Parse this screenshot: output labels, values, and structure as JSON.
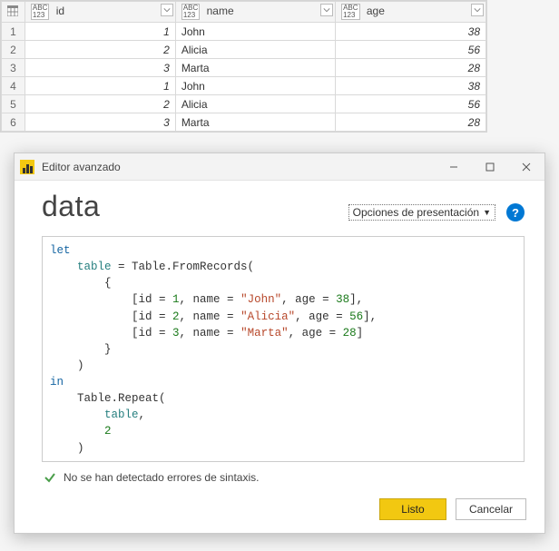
{
  "table": {
    "columns": [
      {
        "name": "id",
        "type_label_top": "ABC",
        "type_label_bot": "123"
      },
      {
        "name": "name",
        "type_label_top": "ABC",
        "type_label_bot": "123"
      },
      {
        "name": "age",
        "type_label_top": "ABC",
        "type_label_bot": "123"
      }
    ],
    "rows": [
      {
        "n": "1",
        "id": "1",
        "name": "John",
        "age": "38"
      },
      {
        "n": "2",
        "id": "2",
        "name": "Alicia",
        "age": "56"
      },
      {
        "n": "3",
        "id": "3",
        "name": "Marta",
        "age": "28"
      },
      {
        "n": "4",
        "id": "1",
        "name": "John",
        "age": "38"
      },
      {
        "n": "5",
        "id": "2",
        "name": "Alicia",
        "age": "56"
      },
      {
        "n": "6",
        "id": "3",
        "name": "Marta",
        "age": "28"
      }
    ]
  },
  "editor": {
    "window_title": "Editor avanzado",
    "query_name": "data",
    "presentation_label": "Opciones de presentación",
    "status_text": "No se han detectado errores de sintaxis.",
    "done_label": "Listo",
    "cancel_label": "Cancelar",
    "code": {
      "kw_let": "let",
      "line_table_assign_pre": "    ",
      "ident_table": "table",
      "eq_from": " = Table.FromRecords(",
      "brace_open": "        {",
      "rec1_a": "            [id = ",
      "rec1_id": "1",
      "rec1_b": ", name = ",
      "rec1_name": "\"John\"",
      "rec1_c": ", age = ",
      "rec1_age": "38",
      "rec1_d": "],",
      "rec2_a": "            [id = ",
      "rec2_id": "2",
      "rec2_b": ", name = ",
      "rec2_name": "\"Alicia\"",
      "rec2_c": ", age = ",
      "rec2_age": "56",
      "rec2_d": "],",
      "rec3_a": "            [id = ",
      "rec3_id": "3",
      "rec3_b": ", name = ",
      "rec3_name": "\"Marta\"",
      "rec3_c": ", age = ",
      "rec3_age": "28",
      "rec3_d": "]",
      "brace_close": "        }",
      "paren_close": "    )",
      "kw_in": "in",
      "repeat_open": "    Table.Repeat(",
      "repeat_tbl_pre": "        ",
      "repeat_comma": ",",
      "repeat_n_pre": "        ",
      "repeat_n": "2",
      "repeat_close": "    )"
    }
  }
}
